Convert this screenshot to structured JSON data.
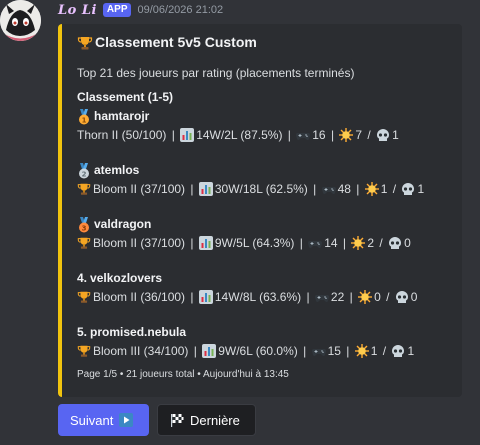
{
  "message": {
    "username": "Lo Li",
    "app_badge": "APP",
    "timestamp": "09/06/2026 21:02"
  },
  "embed": {
    "accent_color": "#f1c40f",
    "title": "Classement 5v5 Custom",
    "description": "Top 21 des joueurs par rating (placements terminés)",
    "section_title": "Classement (1-5)",
    "entries": [
      {
        "medal": "medal-1-icon",
        "name": "hamtarojr",
        "rank": "Thorn II (50/100)",
        "record": "14W/2L (87.5%)",
        "games": "16",
        "wins_label": "7",
        "deaths": "1"
      },
      {
        "medal": "medal-2-icon",
        "name": "atemlos",
        "rank": "Bloom II (37/100)",
        "record": "30W/18L (62.5%)",
        "games": "48",
        "wins_label": "1",
        "deaths": "1"
      },
      {
        "medal": "medal-3-icon",
        "name": "valdragon",
        "rank": "Bloom II (37/100)",
        "record": "9W/5L (64.3%)",
        "games": "14",
        "wins_label": "2",
        "deaths": "0"
      },
      {
        "prefix": "4.",
        "name": "velkozlovers",
        "rank": "Bloom II (36/100)",
        "record": "14W/8L (63.6%)",
        "games": "22",
        "wins_label": "0",
        "deaths": "0"
      },
      {
        "prefix": "5.",
        "name": "promised.nebula",
        "rank": "Bloom III (34/100)",
        "record": "9W/6L (60.0%)",
        "games": "15",
        "wins_label": "1",
        "deaths": "1"
      }
    ],
    "footer": "Page 1/5 • 21 joueurs total • Aujourd'hui à 13:45"
  },
  "buttons": {
    "next_label": "Suivant",
    "last_label": "Dernière"
  }
}
